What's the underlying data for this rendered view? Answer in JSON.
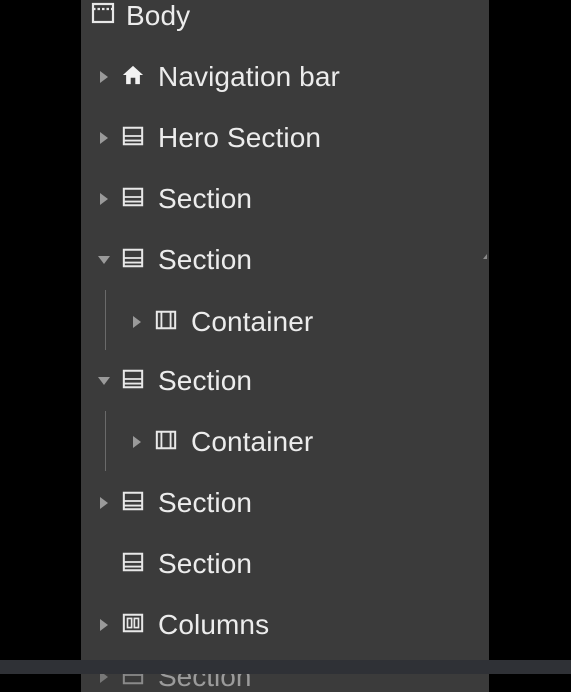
{
  "navigator": {
    "rows": [
      {
        "label": "Body",
        "icon": "body-icon",
        "caret": "none"
      },
      {
        "label": "Navigation bar",
        "icon": "home-icon",
        "caret": "collapsed"
      },
      {
        "label": "Hero Section",
        "icon": "section-icon",
        "caret": "collapsed"
      },
      {
        "label": "Section",
        "icon": "section-icon",
        "caret": "collapsed"
      },
      {
        "label": "Section",
        "icon": "section-icon",
        "caret": "expanded"
      },
      {
        "label": "Container",
        "icon": "container-icon",
        "caret": "collapsed"
      },
      {
        "label": "Section",
        "icon": "section-icon",
        "caret": "expanded"
      },
      {
        "label": "Container",
        "icon": "container-icon",
        "caret": "collapsed"
      },
      {
        "label": "Section",
        "icon": "section-icon",
        "caret": "collapsed"
      },
      {
        "label": "Section",
        "icon": "section-icon",
        "caret": "none"
      },
      {
        "label": "Columns",
        "icon": "columns-icon",
        "caret": "collapsed"
      },
      {
        "label": "Section",
        "icon": "section-icon",
        "caret": "collapsed"
      }
    ]
  },
  "colors": {
    "panel_bg": "#3b3b3b",
    "page_bg": "#000000",
    "text": "#ececec",
    "caret": "#9a9a9a"
  }
}
